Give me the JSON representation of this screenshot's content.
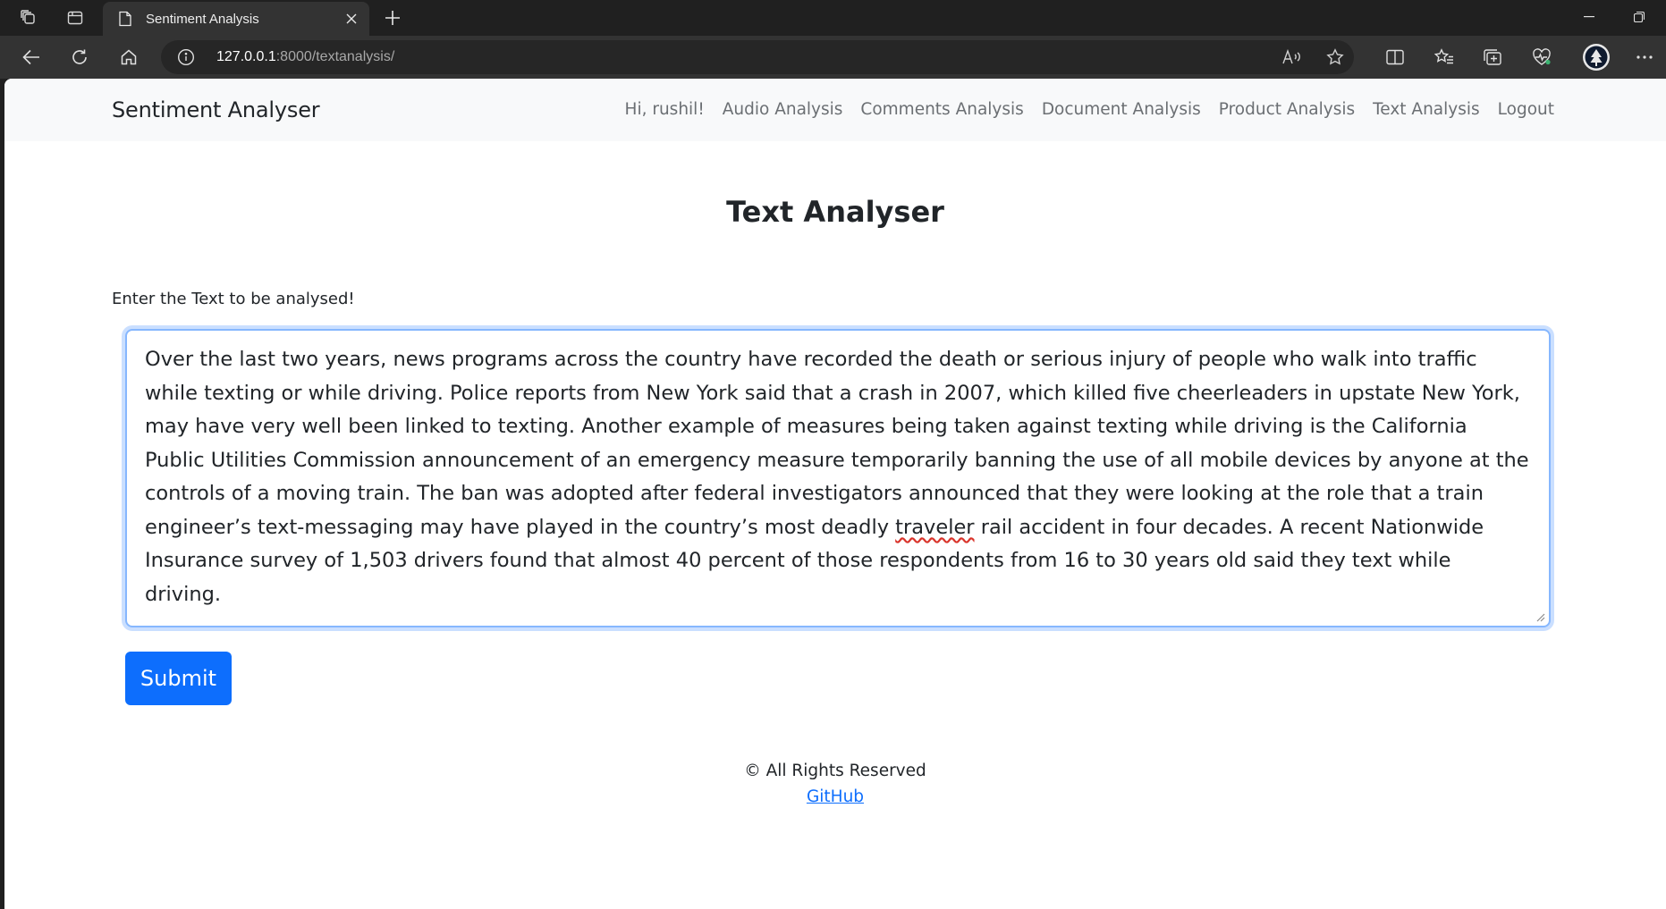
{
  "browser": {
    "tab_title": "Sentiment Analysis",
    "url_host": "127.0.0.1",
    "url_path": ":8000/textanalysis/",
    "icons": [
      "workspaces-icon",
      "tab-actions-icon",
      "page-icon",
      "close-icon",
      "new-tab-icon",
      "minimize-icon",
      "restore-icon",
      "back-icon",
      "refresh-icon",
      "home-icon",
      "info-icon",
      "read-aloud-icon",
      "favorite-star-icon",
      "split-screen-icon",
      "favorites-icon",
      "collections-icon",
      "browser-essentials-icon",
      "profile-avatar-icon",
      "more-icon"
    ]
  },
  "navbar": {
    "brand": "Sentiment Analyser",
    "links": [
      {
        "label": "Hi, rushil!"
      },
      {
        "label": "Audio Analysis"
      },
      {
        "label": "Comments Analysis"
      },
      {
        "label": "Document Analysis"
      },
      {
        "label": "Product Analysis"
      },
      {
        "label": "Text Analysis"
      },
      {
        "label": "Logout"
      }
    ]
  },
  "main": {
    "heading": "Text Analyser",
    "input_label": "Enter the Text to be analysed!",
    "textarea": {
      "text_before": "Over the last two years, news programs across the country have recorded the death or serious injury of people who walk into traffic while texting or while driving. Police reports from New York said that a crash in 2007, which killed five cheerleaders in upstate New York, may have very well been linked to texting. Another example of measures being taken against texting while driving is the California Public Utilities Commission announcement of an emergency measure temporarily banning the use of all mobile devices by anyone at the controls of a moving train.  The ban was adopted after federal investigators announced that they were looking at the role that a train engineer’s text-messaging may have played in the country’s most deadly ",
      "misspelled_word": "traveler",
      "text_after": " rail accident in four decades. A recent Nationwide Insurance survey of 1,503 drivers found that almost 40 percent of those respondents from 16 to 30 years old said they text while driving."
    },
    "submit_label": "Submit"
  },
  "footer": {
    "rights": "© All Rights Reserved",
    "link_label": "GitHub"
  },
  "colors": {
    "primary": "#0d6efd",
    "navbar_bg": "#f8f9fa",
    "focus_border": "#86b7fe",
    "chrome_dark": "#202020",
    "chrome_toolbar": "#333333"
  }
}
